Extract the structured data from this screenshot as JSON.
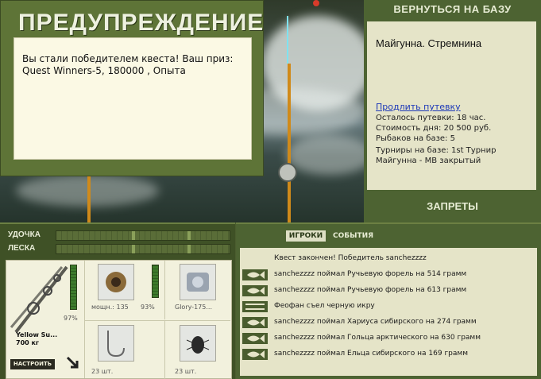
{
  "warning": {
    "title": "ПРЕДУПРЕЖДЕНИЕ",
    "message": "Вы стали победителем квеста! Ваш приз: Quest Winners-5, 180000 , Опыта"
  },
  "base": {
    "back_button": "ВЕРНУТЬСЯ НА БАЗУ",
    "location": "Майгунна. Стремнина",
    "extend_link": "Продлить путевку",
    "lines": [
      "Осталось путевки: 18 час.",
      "Стоимость дня: 20 500 руб.",
      "Рыбаков на базе: 5",
      "",
      "Турниры на базе: 1st Турнир",
      "Майгунна - MB закрытый"
    ],
    "bans_button": "ЗАПРЕТЫ"
  },
  "gauges": {
    "rod_label": "УДОЧКА",
    "line_label": "ЛЕСКА"
  },
  "equipment": {
    "rod_name": "Yellow Su...",
    "rod_weight": "700 кг",
    "rod_percent": "97%",
    "reel_info": "мощн.: 135",
    "reel_percent": "93%",
    "line_name": "Glory-175...",
    "hook_count": "23 шт.",
    "bait_count": "23 шт.",
    "tune_button": "НАСТРОИТЬ"
  },
  "events": {
    "tab_players": "ИГРОКИ",
    "tab_events": "СОБЫТИЯ",
    "items": [
      {
        "icon": "none",
        "text": "Квест закончен! Победитель sanchezzzz"
      },
      {
        "icon": "fish-icon",
        "text": "sanchezzzz поймал Ручьевую форель на 514 грамм"
      },
      {
        "icon": "fish-icon",
        "text": "sanchezzzz поймал Ручьевую форель на 613 грамм"
      },
      {
        "icon": "fork-knife-icon",
        "text": "Феофан съел черную икру"
      },
      {
        "icon": "fish-icon",
        "text": "sanchezzzz поймал Хариуса сибирского на 274 грамм"
      },
      {
        "icon": "fish-icon",
        "text": "sanchezzzz поймал Гольца арктического на 630 грамм"
      },
      {
        "icon": "fish-icon",
        "text": "sanchezzzz поймал Ельца сибирского на 169 грамм"
      }
    ]
  },
  "colors": {
    "panel_green": "#4d6332",
    "cream": "#e5e4c8",
    "link_blue": "#1b37b8"
  }
}
